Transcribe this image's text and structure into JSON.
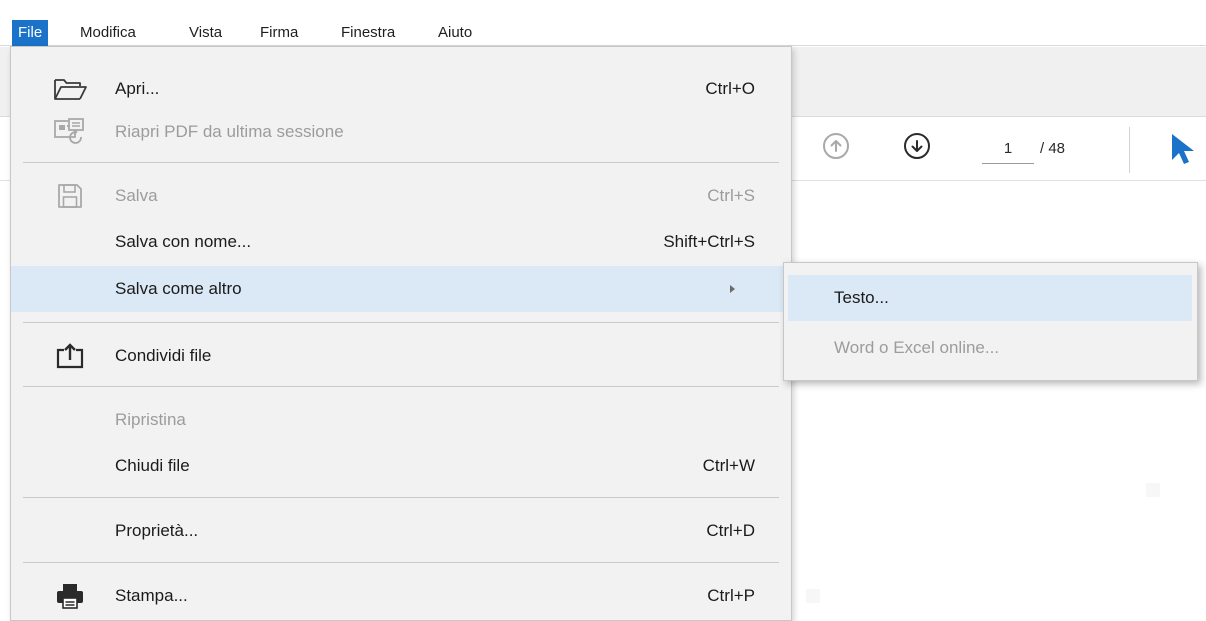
{
  "menubar": {
    "items": [
      {
        "label": "File",
        "active": true
      },
      {
        "label": "Modifica"
      },
      {
        "label": "Vista"
      },
      {
        "label": "Firma"
      },
      {
        "label": "Finestra"
      },
      {
        "label": "Aiuto"
      }
    ]
  },
  "toolbar": {
    "page_current": "1",
    "page_total": "/ 48",
    "prev_icon": "arrow-up-circle-icon",
    "next_icon": "arrow-down-circle-icon",
    "select_tool_icon": "pointer-cursor-icon",
    "select_tool_color": "#1a73c8"
  },
  "file_menu": {
    "items": [
      {
        "id": "apri",
        "label": "Apri...",
        "shortcut": "Ctrl+O",
        "icon": "folder-open-icon",
        "enabled": true
      },
      {
        "id": "riapri",
        "label": "Riapri PDF da ultima sessione",
        "shortcut": "",
        "icon": "reopen-session-icon",
        "enabled": false
      },
      {
        "id": "salva",
        "label": "Salva",
        "shortcut": "Ctrl+S",
        "icon": "save-disk-icon",
        "enabled": false
      },
      {
        "id": "salva-con-nome",
        "label": "Salva con nome...",
        "shortcut": "Shift+Ctrl+S",
        "enabled": true
      },
      {
        "id": "salva-come-altro",
        "label": "Salva come altro",
        "shortcut": "",
        "has_submenu": true,
        "highlighted": true,
        "enabled": true
      },
      {
        "id": "condividi",
        "label": "Condividi file",
        "shortcut": "",
        "icon": "share-upload-icon",
        "enabled": true
      },
      {
        "id": "ripristina",
        "label": "Ripristina",
        "shortcut": "",
        "enabled": false
      },
      {
        "id": "chiudi",
        "label": "Chiudi file",
        "shortcut": "Ctrl+W",
        "enabled": true
      },
      {
        "id": "proprieta",
        "label": "Proprietà...",
        "shortcut": "Ctrl+D",
        "enabled": true
      },
      {
        "id": "stampa",
        "label": "Stampa...",
        "shortcut": "Ctrl+P",
        "icon": "printer-icon",
        "enabled": true
      }
    ]
  },
  "submenu": {
    "items": [
      {
        "id": "testo",
        "label": "Testo...",
        "highlighted": true,
        "enabled": true
      },
      {
        "id": "word-excel",
        "label": "Word o Excel online...",
        "enabled": false
      }
    ]
  },
  "colors": {
    "accent": "#1a73c8",
    "menu_background": "#f2f2f2",
    "highlight": "#dbe8f6",
    "disabled_text": "#9c9c9c"
  }
}
